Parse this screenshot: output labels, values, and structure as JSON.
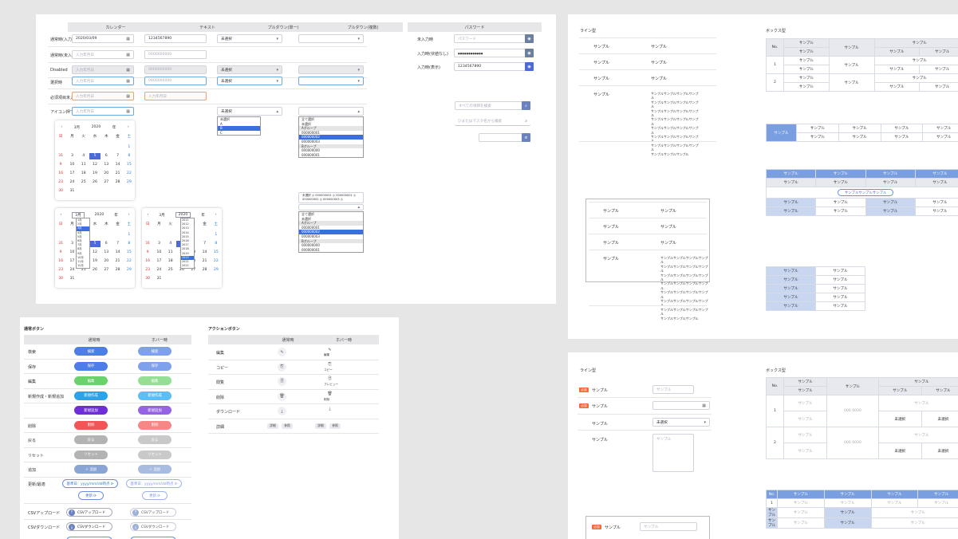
{
  "forms": {
    "headers": {
      "calendar": "カレンダー",
      "text": "テキスト",
      "pulldown_single": "プルダウン(単一)",
      "pulldown_multi": "プルダウン(複数)",
      "password": "パスワード"
    },
    "rows": [
      {
        "label": "通常時(入力時)",
        "date": "2020/03/09",
        "text": "1234567890",
        "select": "未選択"
      },
      {
        "label": "通常時(未入力時)",
        "date": "入力年月日",
        "text": "0000000000"
      },
      {
        "label": "Disabled",
        "date": "入力年月日",
        "text": "0000000000",
        "select": "未選択"
      },
      {
        "label": "選択時",
        "date": "入力年月日",
        "text": "0000000000",
        "select": "未選択"
      },
      {
        "label": "必須項目未入力時",
        "date": "入力年月日",
        "text": "入力年月日"
      },
      {
        "label": "アイコン押下時",
        "date": "入力年月日",
        "select": "未選択"
      }
    ],
    "password_rows": [
      {
        "label": "未入力時",
        "value": "パスワード"
      },
      {
        "label": "入力時(伏値なし)",
        "value": "●●●●●●●●●●●●"
      },
      {
        "label": "入力時(表示)",
        "value": "1234567890"
      }
    ],
    "search1": "すべての項目を検索",
    "search2": "ひまたはマスタ名から検索",
    "single_dropdown": [
      "未選択",
      "A",
      "B",
      "C"
    ],
    "multi_dropdown": [
      "全て選択",
      "未選択",
      "Aグループ",
      "000000001",
      "000000002",
      "000000003",
      "Bグループ",
      "000000000",
      "000000001"
    ],
    "multi_tags": "未選択 ◎  000000001 ◎  000000001 ◎  000000002 ◎  000000003 ◎"
  },
  "calendar": {
    "month": "3月",
    "year": "2020",
    "year_unit": "年",
    "weekdays": [
      "日",
      "月",
      "火",
      "水",
      "木",
      "金",
      "土"
    ],
    "weeks": [
      [
        "",
        "",
        "",
        "",
        "",
        "",
        "1"
      ],
      [
        "31",
        "3",
        "4",
        "5",
        "6",
        "7",
        "8"
      ],
      [
        "9",
        "10",
        "11",
        "12",
        "13",
        "14",
        "15"
      ],
      [
        "16",
        "17",
        "18",
        "19",
        "20",
        "21",
        "22"
      ],
      [
        "23",
        "24",
        "25",
        "26",
        "27",
        "28",
        "29"
      ],
      [
        "30",
        "31",
        "",
        "",
        "",
        "",
        ""
      ]
    ],
    "month_list": [
      "1月",
      "2月",
      "3月",
      "4月",
      "5月",
      "6月",
      "7月",
      "8月",
      "9月",
      "10月",
      "11月",
      "12月"
    ],
    "year_list": [
      "2011",
      "2012",
      "2013",
      "2014",
      "2015",
      "2016",
      "2017",
      "2018",
      "2019",
      "2020",
      "2021",
      "2022"
    ]
  },
  "buttons": {
    "title": "通常ボタン",
    "col_normal": "通常時",
    "col_hover": "ホバー時",
    "rows": [
      {
        "label": "検索",
        "text": "検索",
        "color": "#4d7de8",
        "hover": "#7fa1ec"
      },
      {
        "label": "保存",
        "text": "保存",
        "color": "#4d7de8",
        "hover": "#7fa1ec"
      },
      {
        "label": "編集",
        "text": "編集",
        "color": "#6bd16b",
        "hover": "#95df95"
      },
      {
        "label": "新規作成・新規追加",
        "text": "新規作成",
        "color": "#29a4ec",
        "hover": "#60bdf2"
      },
      {
        "label": "",
        "text": "新規追加",
        "color": "#6f2fd8",
        "hover": "#9563e3"
      },
      {
        "label": "削除",
        "text": "削除",
        "color": "#f25555",
        "hover": "#f68787"
      },
      {
        "label": "戻る",
        "text": "戻る",
        "color": "#b3b3b3",
        "hover": "#c9c9c9"
      },
      {
        "label": "リセット",
        "text": "リセット",
        "color": "#b3b3b3",
        "hover": "#c9c9c9"
      },
      {
        "label": "追加",
        "text": "＋ 追加",
        "color": "#8aa4d6",
        "hover": "#a8bbe0"
      }
    ],
    "refresh": {
      "label": "更新/最適",
      "text1": "基準日：yyyy/mm/dd時点 ⟳",
      "text2": "更新 ⟳"
    },
    "csv_up": {
      "label": "CSVアップロード",
      "text": "CSVアップロード"
    },
    "csv_down": {
      "label": "CSVダウンロード",
      "text": "CSVダウンロード"
    }
  },
  "actions": {
    "title": "アクションボタン",
    "col_normal": "通常時",
    "col_hover": "ホバー時",
    "rows": [
      {
        "label": "編集",
        "icon": "✎",
        "hover_text": "編集"
      },
      {
        "label": "コピー",
        "icon": "⎘",
        "hover_text": "コピー"
      },
      {
        "label": "閲覧",
        "icon": "🗎",
        "hover_text": "プレビュー"
      },
      {
        "label": "削除",
        "icon": "🗑",
        "hover_text": "削除"
      },
      {
        "label": "ダウンロード",
        "icon": "⤓",
        "hover_text": ""
      },
      {
        "label": "詳細",
        "chip1": "詳細",
        "chip2": "参照"
      }
    ]
  },
  "tables": {
    "line_title": "ライン型",
    "box_title": "ボックス型",
    "sample": "サンプル",
    "no": "No.",
    "long": "サンプルサンプルサンプルサンプル",
    "pill": "サンプルサンプルサンプル",
    "inputs_title": "ライン型",
    "inputs_box_title": "ボックス型",
    "required": "必須",
    "unselected": "未選択",
    "placeholder": "サンプル",
    "date_ph": "サンプル",
    "from": "000",
    "to": "0000"
  }
}
